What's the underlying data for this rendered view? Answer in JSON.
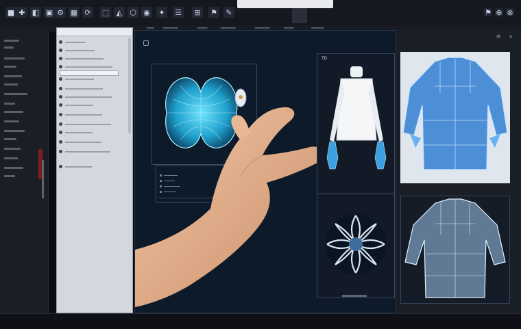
{
  "toolbar": {
    "tools": [
      "■",
      "✚",
      "◧",
      "▣",
      "⚙",
      "▦",
      "⟳",
      "⬚",
      "◭",
      "⬡",
      "◉",
      "✦",
      "☰",
      "⊞",
      "⚑",
      "✎"
    ],
    "right_icons": [
      "⚑",
      "⊕",
      "⊗"
    ]
  },
  "menubar": {
    "items": [
      "━━━━━━━",
      "━━━━",
      "━━━━━",
      "━━━",
      "━━━━━━",
      "━━━━",
      "━━━━━━",
      "━━━━━━",
      "━━━━",
      "━━━━━"
    ]
  },
  "panel": {
    "rows": [
      {
        "icon": "circle",
        "text": ""
      },
      {
        "icon": "circle",
        "text": ""
      },
      {
        "icon": "circle",
        "text": ""
      },
      {
        "icon": "circle",
        "text": ""
      },
      {
        "icon": "circle",
        "text": ""
      },
      {
        "icon": "circle",
        "text": ""
      },
      {
        "icon": "circle",
        "text": ""
      },
      {
        "icon": "circle",
        "text": ""
      },
      {
        "icon": "circle",
        "text": ""
      },
      {
        "icon": "circle",
        "text": ""
      },
      {
        "icon": "circle",
        "text": ""
      },
      {
        "icon": "circle",
        "text": ""
      },
      {
        "icon": "circle",
        "text": ""
      },
      {
        "icon": "circle",
        "text": ""
      }
    ]
  },
  "viewport": {
    "label": "",
    "frame1_label": "",
    "frame2_label": ""
  },
  "right_panel": {
    "label": "TD",
    "label2": ""
  },
  "colors": {
    "accent": "#2f7fd8",
    "garment_blue": "#4d8fd6",
    "mesh_cyan": "#3ec3e6",
    "alert_red": "#7d1c22"
  }
}
